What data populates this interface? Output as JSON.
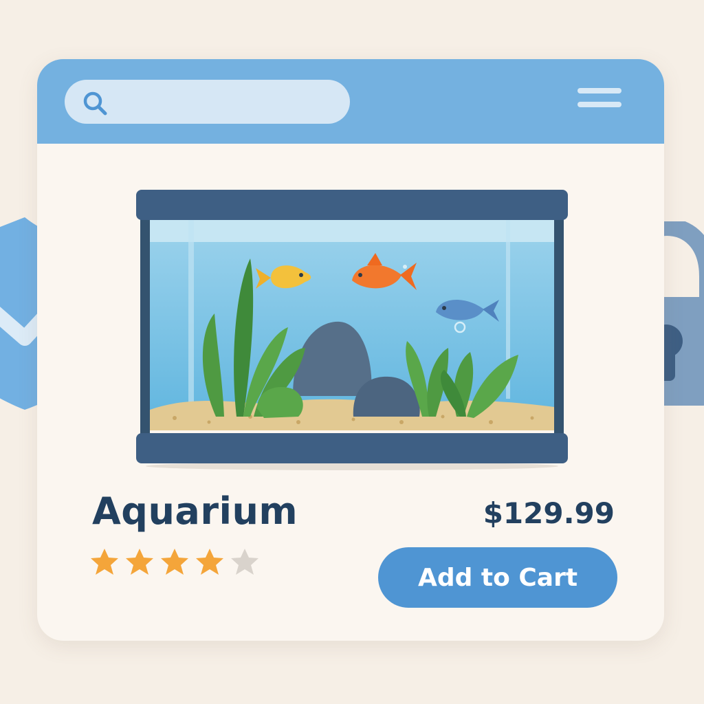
{
  "search": {
    "value": "",
    "placeholder": ""
  },
  "product": {
    "title": "Aquarium",
    "price": "$129.99",
    "rating": 4,
    "rating_max": 5
  },
  "cart": {
    "button_label": "Add to Cart"
  },
  "icons": {
    "search": "search-icon",
    "menu": "hamburger-menu-icon",
    "shield": "shield-check-icon",
    "lock": "padlock-icon"
  },
  "colors": {
    "topbar": "#74b1e0",
    "accent": "#4f95d3",
    "text": "#22405f",
    "star_filled": "#f4a53a",
    "star_empty": "#d9d3cc"
  }
}
